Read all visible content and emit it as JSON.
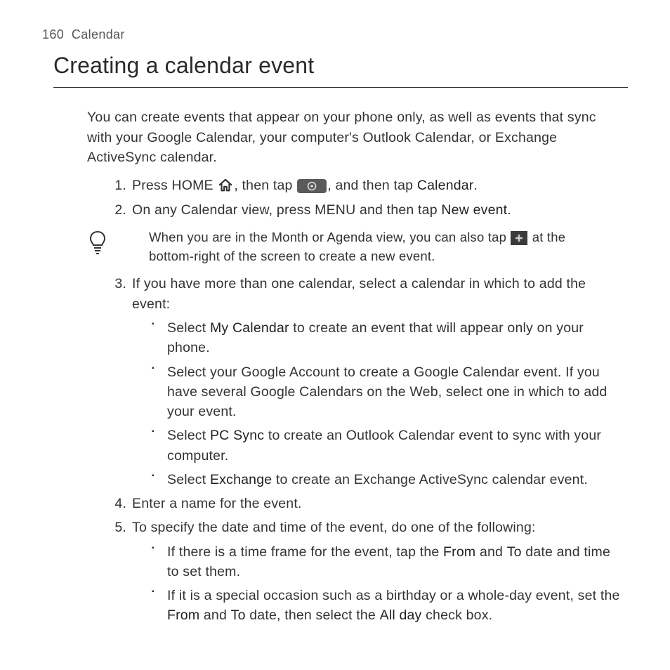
{
  "header": {
    "page_number": "160",
    "section": "Calendar"
  },
  "title": "Creating a calendar event",
  "intro": "You can create events that appear on your phone only, as well as events that sync with your Google Calendar, your computer's Outlook Calendar, or Exchange ActiveSync calendar.",
  "steps": {
    "s1": {
      "num": "1.",
      "t1": "Press HOME ",
      "t2": ", then tap ",
      "t3": ", and then tap ",
      "bold": "Calendar",
      "t4": "."
    },
    "s2": {
      "num": "2.",
      "t1": "On any Calendar view, press MENU and then tap ",
      "bold": "New event",
      "t2": "."
    },
    "tip": {
      "t1": "When you are in the Month or Agenda view, you can also tap ",
      "t2": " at the bottom-right of the screen to create a new event."
    },
    "s3": {
      "num": "3.",
      "t1": "If you have more than one calendar, select a calendar in which to add the event:",
      "b1a": "Select ",
      "b1bold": "My Calendar",
      "b1b": " to create an event that will appear only on your phone.",
      "b2": "Select your Google Account to create a Google Calendar event. If you have several Google Calendars on the Web, select one in which to add your event.",
      "b3a": "Select ",
      "b3bold": "PC Sync",
      "b3b": " to create an Outlook Calendar event to sync with your computer.",
      "b4a": "Select ",
      "b4bold": "Exchange",
      "b4b": " to create an Exchange ActiveSync calendar event."
    },
    "s4": {
      "num": "4.",
      "t1": "Enter a name for the event."
    },
    "s5": {
      "num": "5.",
      "t1": "To specify the date and time of the event, do one of the following:",
      "b1a": "If there is a time frame for the event, tap the ",
      "b1bold1": "From",
      "b1b": " and ",
      "b1bold2": "To",
      "b1c": " date and time to set them.",
      "b2a": "If it is a special occasion such as a birthday or a whole-day event, set the ",
      "b2bold1": "From",
      "b2b": " and ",
      "b2bold2": "To",
      "b2c": " date, then select the ",
      "b2bold3": "All day",
      "b2d": " check box."
    }
  }
}
